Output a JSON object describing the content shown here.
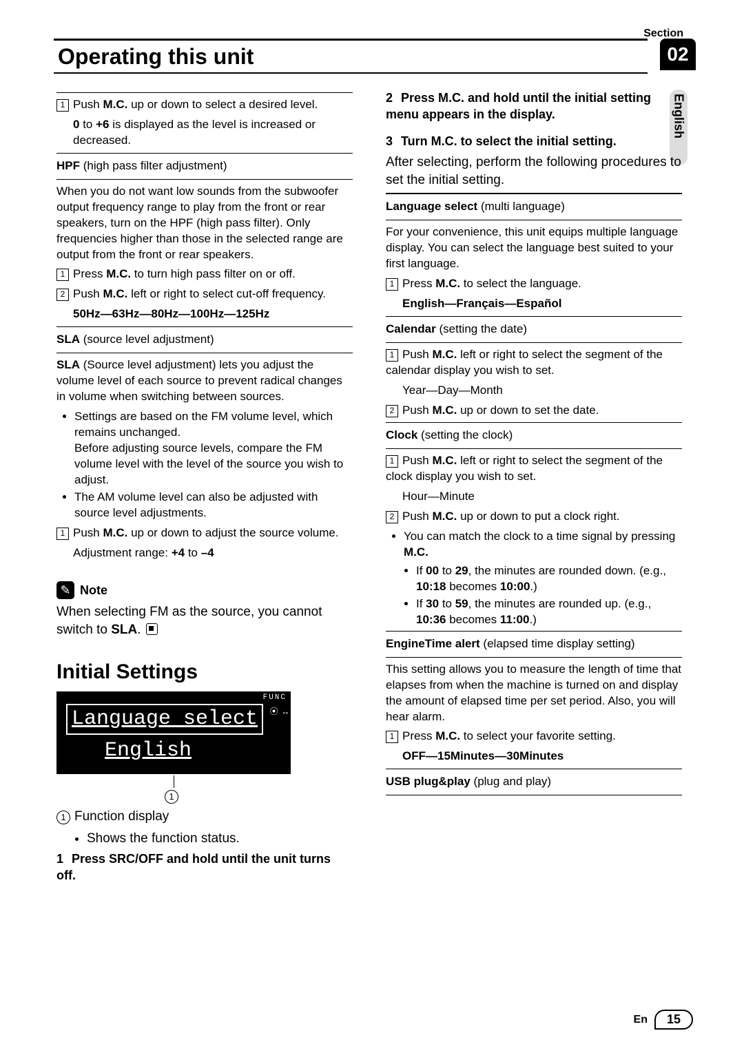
{
  "header": {
    "title": "Operating this unit",
    "section_label": "Section",
    "section_num": "02",
    "side_lang": "English"
  },
  "left": {
    "loud_step": "Push <b>M.C.</b> up or down to select a desired level.",
    "loud_range": "<b>0</b> to <b>+6</b> is displayed as the level is increased or decreased.",
    "hpf_title": "<b>HPF</b> <span class='sub'>(high pass filter adjustment)</span>",
    "hpf_desc": "When you do not want low sounds from the subwoofer output frequency range to play from the front or rear speakers, turn on the HPF (high pass filter). Only frequencies higher than those in the selected range are output from the front or rear speakers.",
    "hpf_s1": "Press <b>M.C.</b> to turn high pass filter on or off.",
    "hpf_s2": "Push <b>M.C.</b> left or right to select cut-off frequency.",
    "hpf_freq": "50Hz—63Hz—80Hz—100Hz—125Hz",
    "sla_title": "<b>SLA</b> <span class='sub'>(source level adjustment)</span>",
    "sla_desc": "<b>SLA</b> (Source level adjustment) lets you adjust the volume level of each source to prevent radical changes in volume when switching between sources.",
    "sla_b1": "Settings are based on the FM volume level, which remains unchanged.",
    "sla_b1b": "Before adjusting source levels, compare the FM volume level with the level of the source you wish to adjust.",
    "sla_b2": "The AM volume level can also be adjusted with source level adjustments.",
    "sla_s1": "Push <b>M.C.</b> up or down to adjust the source volume.",
    "sla_range": "Adjustment range: <b>+4</b> to <b>–4</b>",
    "note_label": "Note",
    "note_text": "When selecting FM as the source, you cannot switch to <b>SLA</b>.",
    "initial_heading": "Initial Settings",
    "display": {
      "func": "FUNC",
      "row1": "Language select",
      "row2": "English",
      "glyphs": "↕\n⦿\n↔"
    },
    "callout_num": "1",
    "callout_label": "Function display",
    "callout_bullet": "Shows the function status.",
    "step1": "Press SRC/OFF and hold until the unit turns off."
  },
  "right": {
    "step2": "Press M.C. and hold until the initial setting menu appears in the display.",
    "step3": "Turn M.C. to select the initial setting.",
    "after": "After selecting, perform the following procedures to set the initial setting.",
    "lang_title": "<b>Language select</b> <span class='sub'>(multi language)</span>",
    "lang_desc": "For your convenience, this unit equips multiple language display. You can select the language best suited to your first language.",
    "lang_s1": "Press <b>M.C.</b> to select the language.",
    "lang_opts": "English—Français—Español",
    "cal_title": "<b>Calendar</b> <span class='sub'>(setting the date)</span>",
    "cal_s1": "Push <b>M.C.</b> left or right to select the segment of the calendar display you wish to set.",
    "cal_s1b": "Year—Day—Month",
    "cal_s2": "Push <b>M.C.</b> up or down to set the date.",
    "clk_title": "<b>Clock</b> <span class='sub'>(setting the clock)</span>",
    "clk_s1": "Push <b>M.C.</b> left or right to select the segment of the clock display you wish to set.",
    "clk_s1b": "Hour—Minute",
    "clk_s2": "Push <b>M.C.</b> up or down to put a clock right.",
    "clk_b1": "You can match the clock to a time signal by pressing <b>M.C.</b>",
    "clk_b1a": "If <b>00</b> to <b>29</b>, the minutes are rounded down. (e.g., <b>10:18</b> becomes <b>10:00</b>.)",
    "clk_b1b": "If <b>30</b> to <b>59</b>, the minutes are rounded up. (e.g., <b>10:36</b> becomes <b>11:00</b>.)",
    "eng_title": "<b>EngineTime alert</b> <span class='sub'>(elapsed time display setting)</span>",
    "eng_desc": "This setting allows you to measure the length of time that elapses from when the machine is turned on and display the amount of elapsed time per set period. Also, you will hear alarm.",
    "eng_s1": "Press <b>M.C.</b> to select your favorite setting.",
    "eng_opts": "OFF—15Minutes—30Minutes",
    "usb_title": "<b>USB plug&amp;play</b> <span class='sub'>(plug and play)</span>"
  },
  "footer": {
    "lang": "En",
    "page": "15"
  }
}
